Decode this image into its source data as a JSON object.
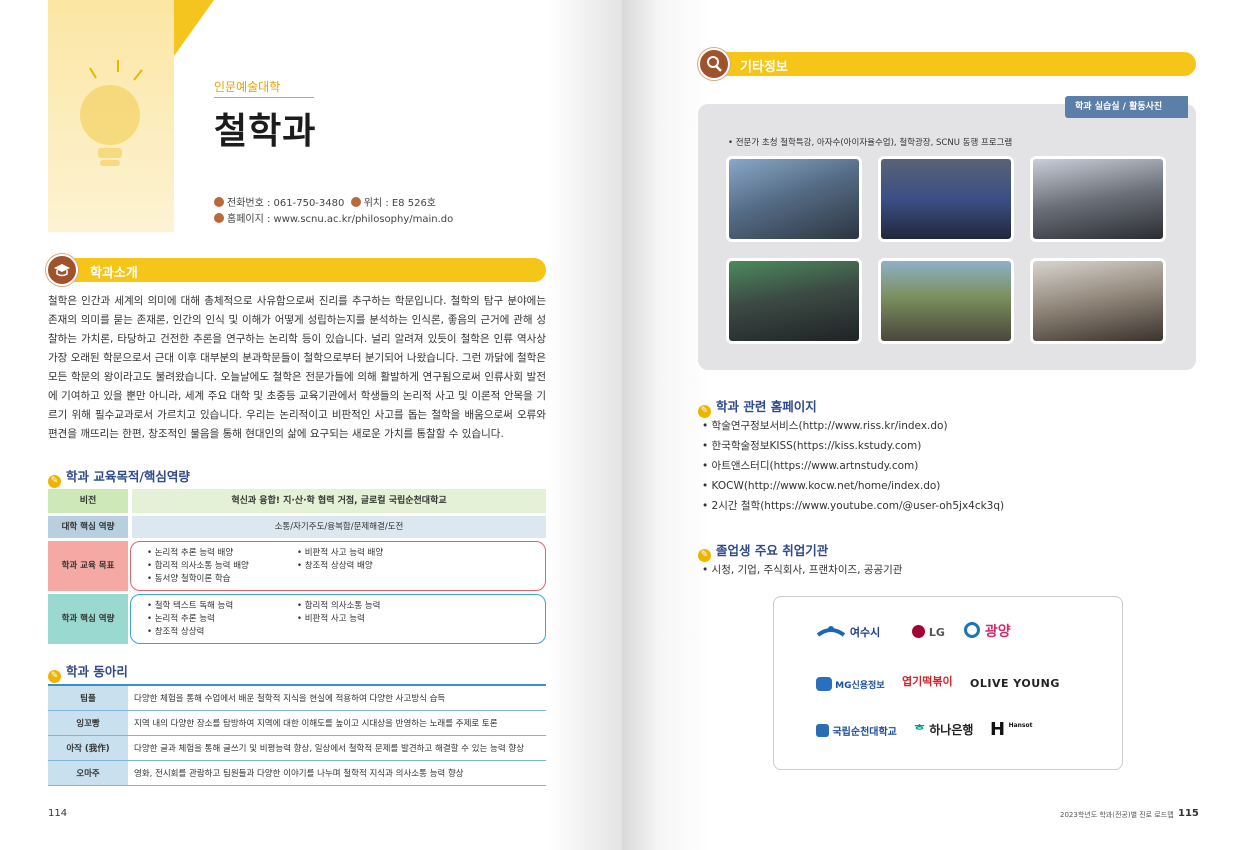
{
  "left_page": {
    "college": "인문예술대학",
    "department": "철학과",
    "phone": "전화번호 : 061-750-3480",
    "location": "위치 : E8 526호",
    "homepage": "홈페이지 : www.scnu.ac.kr/philosophy/main.do",
    "intro_title": "학과소개",
    "intro_text": "철학은 인간과 세계의 의미에 대해 총체적으로 사유함으로써 진리를 추구하는 학문입니다. 철학의 탐구 분야에는 존재의 의미를 묻는 존재론, 인간의 인식 및 이해가 어떻게 성립하는지를 분석하는 인식론, 좋음의 근거에 관해 성찰하는 가치론, 타당하고 건전한 추론을 연구하는 논리학 등이 있습니다. 널리 알려져 있듯이 철학은 인류 역사상 가장 오래된 학문으로서 근대 이후 대부분의 분과학문들이 철학으로부터 분기되어 나왔습니다. 그런 까닭에 철학은 모든 학문의 왕이라고도 불려왔습니다. 오늘날에도 철학은 전문가들에 의해 활발하게 연구됨으로써 인류사회 발전에 기여하고 있을 뿐만 아니라, 세계 주요 대학 및 초중등 교육기관에서 학생들의 논리적 사고 및 이론적 안목을 기르기 위해 필수교과로서 가르치고 있습니다. 우리는 논리적이고 비판적인 사고를 돕는 철학을 배움으로써 오류와 편견을 깨뜨리는 한편, 창조적인 물음을 통해 현대인의 삶에 요구되는 새로운 가치를 통찰할 수 있습니다.",
    "edu_title": "학과 교육목적/핵심역량",
    "vision_label": "비전",
    "vision_text": "혁신과 융합! 지·산·학 협력 거점, 글로컬 국립순천대학교",
    "core_label": "대학 핵심 역량",
    "core_text": "소통/자기주도/융복합/문제해결/도전",
    "goal_label": "학과 교육 목표",
    "goals_col1": [
      "• 논리적 추론 능력 배양",
      "• 합리적 의사소통 능력 배양",
      "• 동서양 철학이론 학습"
    ],
    "goals_col2": [
      "• 비판적 사고 능력 배양",
      "• 창조적 상상력 배양"
    ],
    "comp_label": "학과 핵심 역량",
    "comp_col1": [
      "• 철학 텍스트 독해 능력",
      "• 논리적 추론 능력",
      "• 창조적 상상력"
    ],
    "comp_col2": [
      "• 합리적 의사소통 능력",
      "• 비판적 사고 능력"
    ],
    "club_title": "학과 동아리",
    "clubs": [
      {
        "name": "팀플",
        "desc": "다양한 체험을 통해 수업에서 배운 철학적 지식을 현실에 적용하여 다양한 사고방식 습득"
      },
      {
        "name": "잉꼬빵",
        "desc": "지역 내의 다양한 장소를 탐방하여 지역에 대한 이해도를 높이고 시대상을 반영하는 노래를 주제로 토론"
      },
      {
        "name": "아작 (我作)",
        "desc": "다양한 글과 체험을 통해 글쓰기 및 비평능력 향상, 일상에서 철학적 문제를 발견하고 해결할 수 있는 능력 향상"
      },
      {
        "name": "오마주",
        "desc": "영화, 전시회를 관람하고 팀원들과 다양한 이야기를 나누며 철학적 지식과 의사소통 능력 향상"
      }
    ],
    "page_number": "114"
  },
  "right_page": {
    "section_title": "기타정보",
    "gallery_tag": "학과 실습실 / 활동사진",
    "gallery_caption": "• 전문가 초청 철학특강, 아자수(아이자율수업), 철학광장, SCNU 동행 프로그램",
    "links_title": "학과 관련 홈페이지",
    "links": [
      "• 학술연구정보서비스(http://www.riss.kr/index.do)",
      "• 한국학술정보KISS(https://kiss.kstudy.com)",
      "• 아트앤스터디(https://www.artnstudy.com)",
      "• KOCW(http://www.kocw.net/home/index.do)",
      "• 2시간 철학(https://www.youtube.com/@user-oh5jx4ck3q)"
    ],
    "jobs_title": "졸업생 주요 취업기관",
    "jobs_text": "• 시청, 기업, 주식회사, 프랜차이즈, 공공기관",
    "logos": {
      "yeosu": "여수시",
      "lg": "LG",
      "gwangyang": "광양",
      "mg": "MG신용정보",
      "yeopgi": "엽기떡볶이",
      "oliveyoung": "OLIVE YOUNG",
      "scnu": "국립순천대학교",
      "hana": "하나은행",
      "hansot": "Hansot"
    },
    "footer_label": "2023학년도 학과(전공)별 진로 로드맵",
    "page_number": "115"
  },
  "colors": {
    "accent_yellow": "#f5c518",
    "section_brown": "#a0522d",
    "subhead_blue": "#2f4a8a"
  }
}
